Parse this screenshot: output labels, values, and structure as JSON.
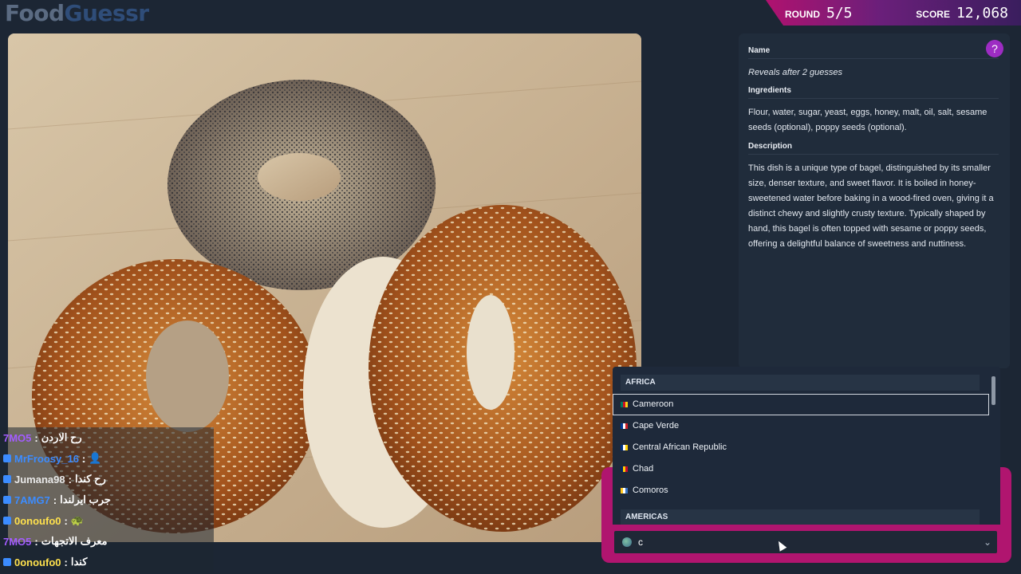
{
  "app": {
    "logo_part1": "Food",
    "logo_part2": "Guessr"
  },
  "banner": {
    "round_label": "ROUND",
    "round_value": "5/5",
    "score_label": "SCORE",
    "score_value": "12,068"
  },
  "info": {
    "name_heading": "Name",
    "name_value": "Reveals after 2 guesses",
    "ingredients_heading": "Ingredients",
    "ingredients_value": "Flour, water, sugar, yeast, eggs, honey, malt, oil, salt, sesame seeds (optional), poppy seeds (optional).",
    "description_heading": "Description",
    "description_value": "This dish is a unique type of bagel, distinguished by its smaller size, denser texture, and sweet flavor. It is boiled in honey-sweetened water before baking in a wood-fired oven, giving it a distinct chewy and slightly crusty texture. Typically shaped by hand, this bagel is often topped with sesame or poppy seeds, offering a delightful balance of sweetness and nuttiness.",
    "help_icon": "question-circle-icon"
  },
  "chat": [
    {
      "user": "7MO5",
      "text": "رح الاردن",
      "user_color": "#a35cff"
    },
    {
      "user": "MrFroosy_16",
      "text": "👤",
      "user_color": "#3c8cff"
    },
    {
      "user": "Jumana98",
      "text": "رح كندا",
      "user_color": "#e8e8e8"
    },
    {
      "user": "7AMG7",
      "text": "جرب ايرلندا",
      "user_color": "#3c8cff"
    },
    {
      "user": "0onoufo0",
      "text": "🐢",
      "user_color": "#ffe14d"
    },
    {
      "user": "7MO5",
      "text": "معرف الاتجهات",
      "user_color": "#a35cff"
    },
    {
      "user": "0onoufo0",
      "text": "كندا",
      "user_color": "#ffe14d"
    }
  ],
  "dropdown": {
    "group1": "AFRICA",
    "options": [
      {
        "label": "Cameroon",
        "flag": [
          "#007a5e",
          "#ce1126",
          "#fcd116"
        ]
      },
      {
        "label": "Cape Verde",
        "flag": [
          "#003893",
          "#ffffff",
          "#cf2027"
        ]
      },
      {
        "label": "Central African Republic",
        "flag": [
          "#003082",
          "#ffffff",
          "#ffce00"
        ]
      },
      {
        "label": "Chad",
        "flag": [
          "#002664",
          "#fecb00",
          "#c60c30"
        ]
      },
      {
        "label": "Comoros",
        "flag": [
          "#ffc61e",
          "#ffffff",
          "#3a75c4"
        ]
      }
    ],
    "group2": "AMERICAS"
  },
  "search": {
    "value": "c"
  }
}
